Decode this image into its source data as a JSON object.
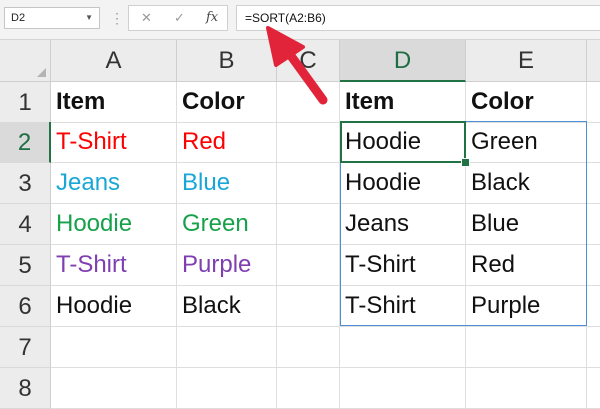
{
  "name_box": {
    "value": "D2"
  },
  "formula_bar": {
    "cancel_glyph": "✕",
    "enter_glyph": "✓",
    "fx_label": "fx",
    "formula": "=SORT(A2:B6)"
  },
  "columns": [
    "A",
    "B",
    "C",
    "D",
    "E"
  ],
  "rows": [
    "1",
    "2",
    "3",
    "4",
    "5",
    "6",
    "7",
    "8"
  ],
  "selected_cell": "D2",
  "cells": {
    "A1": "Item",
    "B1": "Color",
    "D1": "Item",
    "E1": "Color",
    "A2": "T-Shirt",
    "B2": "Red",
    "D2": "Hoodie",
    "E2": "Green",
    "A3": "Jeans",
    "B3": "Blue",
    "D3": "Hoodie",
    "E3": "Black",
    "A4": "Hoodie",
    "B4": "Green",
    "D4": "Jeans",
    "E4": "Blue",
    "A5": "T-Shirt",
    "B5": "Purple",
    "D5": "T-Shirt",
    "E5": "Red",
    "A6": "Hoodie",
    "B6": "Black",
    "D6": "T-Shirt",
    "E6": "Purple"
  },
  "colors": {
    "red": "#ff0000",
    "blue": "#19a7d8",
    "green": "#16a14a",
    "purple": "#7f3fb0",
    "black": "#111111",
    "excel_green": "#217346",
    "spill_border": "#4d8fd6",
    "annotation_arrow": "#e2243b"
  }
}
